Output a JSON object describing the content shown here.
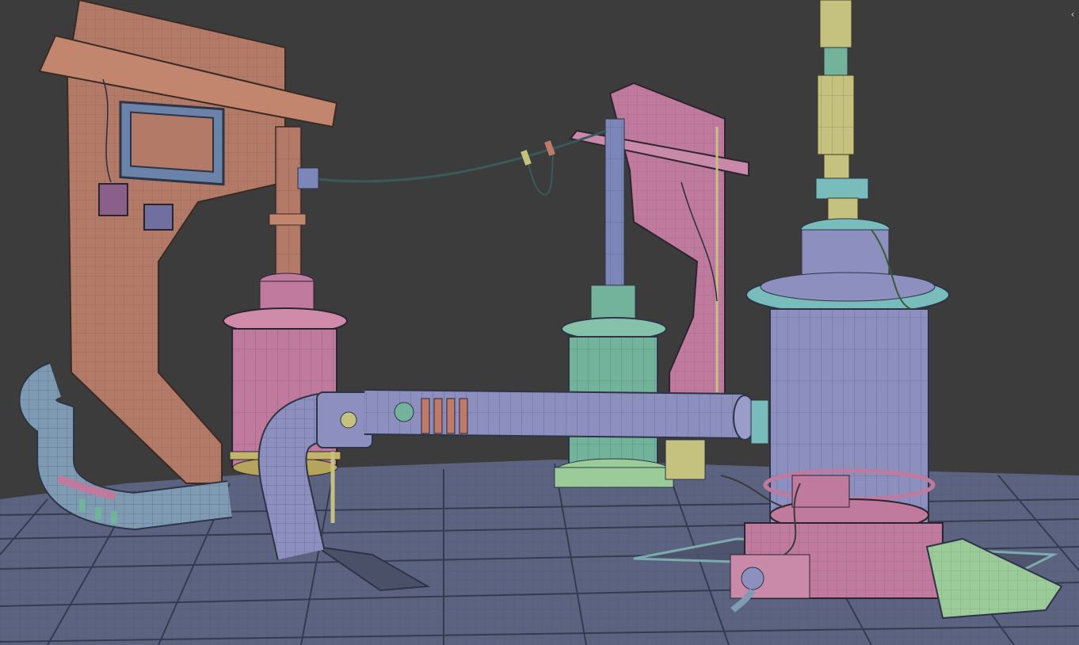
{
  "viewport": {
    "background": "#3c3c3c",
    "grid_color": "#5e6683",
    "collapse_icon": "chevron-left-icon",
    "collapse_glyph": "‹"
  },
  "palette": {
    "floor": "#5b6380",
    "floor_line": "#2f3346",
    "wire": "#23263a",
    "orange": "#b47a68",
    "pink": "#c07a9e",
    "lilac": "#8d8fbf",
    "steel": "#7f9bb3",
    "mint": "#74b39b",
    "olive": "#c4c27e",
    "cyan": "#78bcbc",
    "green": "#9acb98"
  },
  "objects": [
    "floor-grid",
    "left-orange-panel",
    "left-pink-cylinder",
    "left-elbow-pipe",
    "back-pink-panel",
    "center-green-cylinder",
    "horizontal-lilac-pipe",
    "right-lilac-tower",
    "yellow-antenna",
    "cable",
    "left-vent-pipe"
  ]
}
